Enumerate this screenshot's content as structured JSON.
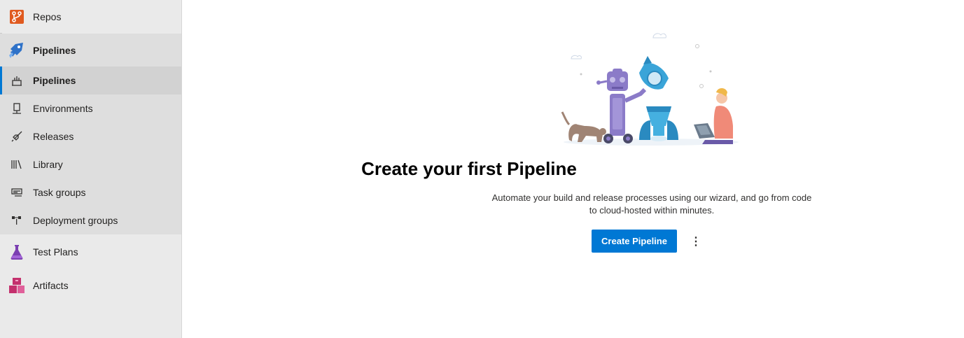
{
  "sidebar": {
    "repos": {
      "label": "Repos",
      "icon": "repos-icon"
    },
    "pipelines_group": {
      "label": "Pipelines",
      "icon": "pipelines-icon"
    },
    "sub_items": [
      {
        "label": "Pipelines",
        "icon": "pipeline-icon"
      },
      {
        "label": "Environments",
        "icon": "environments-icon"
      },
      {
        "label": "Releases",
        "icon": "rocket-icon"
      },
      {
        "label": "Library",
        "icon": "library-icon"
      },
      {
        "label": "Task groups",
        "icon": "task-groups-icon"
      },
      {
        "label": "Deployment groups",
        "icon": "deployment-groups-icon"
      }
    ],
    "test_plans": {
      "label": "Test Plans",
      "icon": "test-plans-icon"
    },
    "artifacts": {
      "label": "Artifacts",
      "icon": "artifacts-icon"
    }
  },
  "main": {
    "title": "Create your first Pipeline",
    "description": "Automate your build and release processes using our wizard, and go from code to cloud-hosted within minutes.",
    "create_button": "Create Pipeline",
    "more_label": "⋮"
  },
  "colors": {
    "accent": "#0078d4",
    "repos": "#e05a1f",
    "pipelines": "#2f72c8",
    "test_plans": "#7b3fb1",
    "artifacts": "#c4306d"
  }
}
